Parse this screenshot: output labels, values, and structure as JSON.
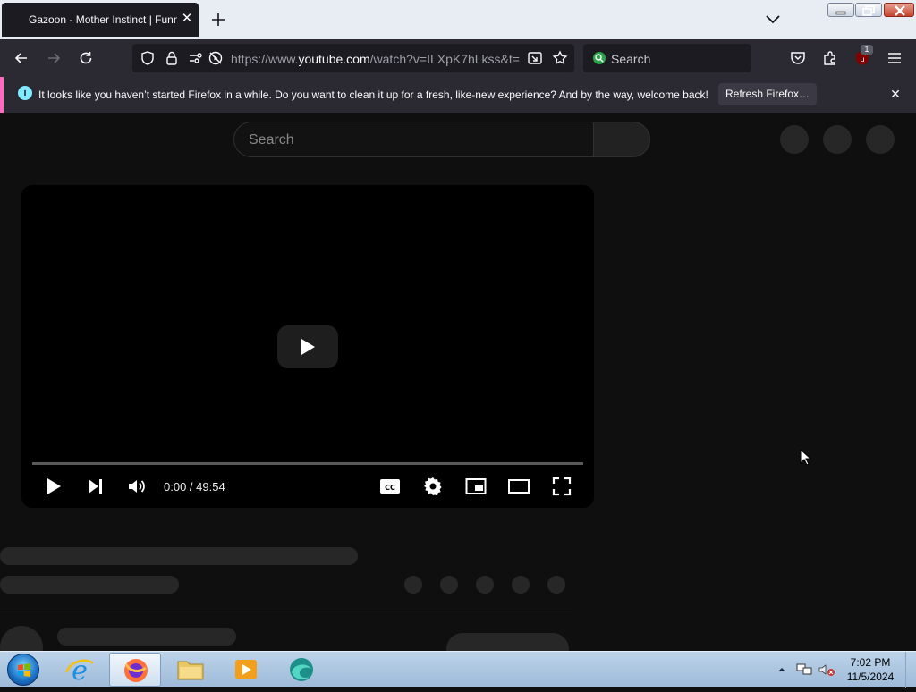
{
  "browser": {
    "tab": {
      "title": "Gazoon - Mother Instinct | Funny Cartoons"
    },
    "url": {
      "prefix": "https://www.",
      "domain": "youtube.com",
      "path": "/watch?v=ILXpK7hLkss&t="
    },
    "search": {
      "placeholder": "Search"
    },
    "extension_badge": "1"
  },
  "notification": {
    "message": "It looks like you haven’t started Firefox in a while. Do you want to clean it up for a fresh, like-new experience? And by the way, welcome back!",
    "button": "Refresh Firefox…",
    "accent_color": "#ff6ac0"
  },
  "youtube": {
    "search_placeholder": "Search",
    "player": {
      "current_time": "0:00",
      "duration": "49:54",
      "time_display": "0:00 / 49:54",
      "progress": 0
    }
  },
  "taskbar": {
    "time": "7:02 PM",
    "date": "11/5/2024",
    "items": [
      "internet-explorer",
      "firefox",
      "file-explorer",
      "media-player",
      "browser-app"
    ]
  }
}
